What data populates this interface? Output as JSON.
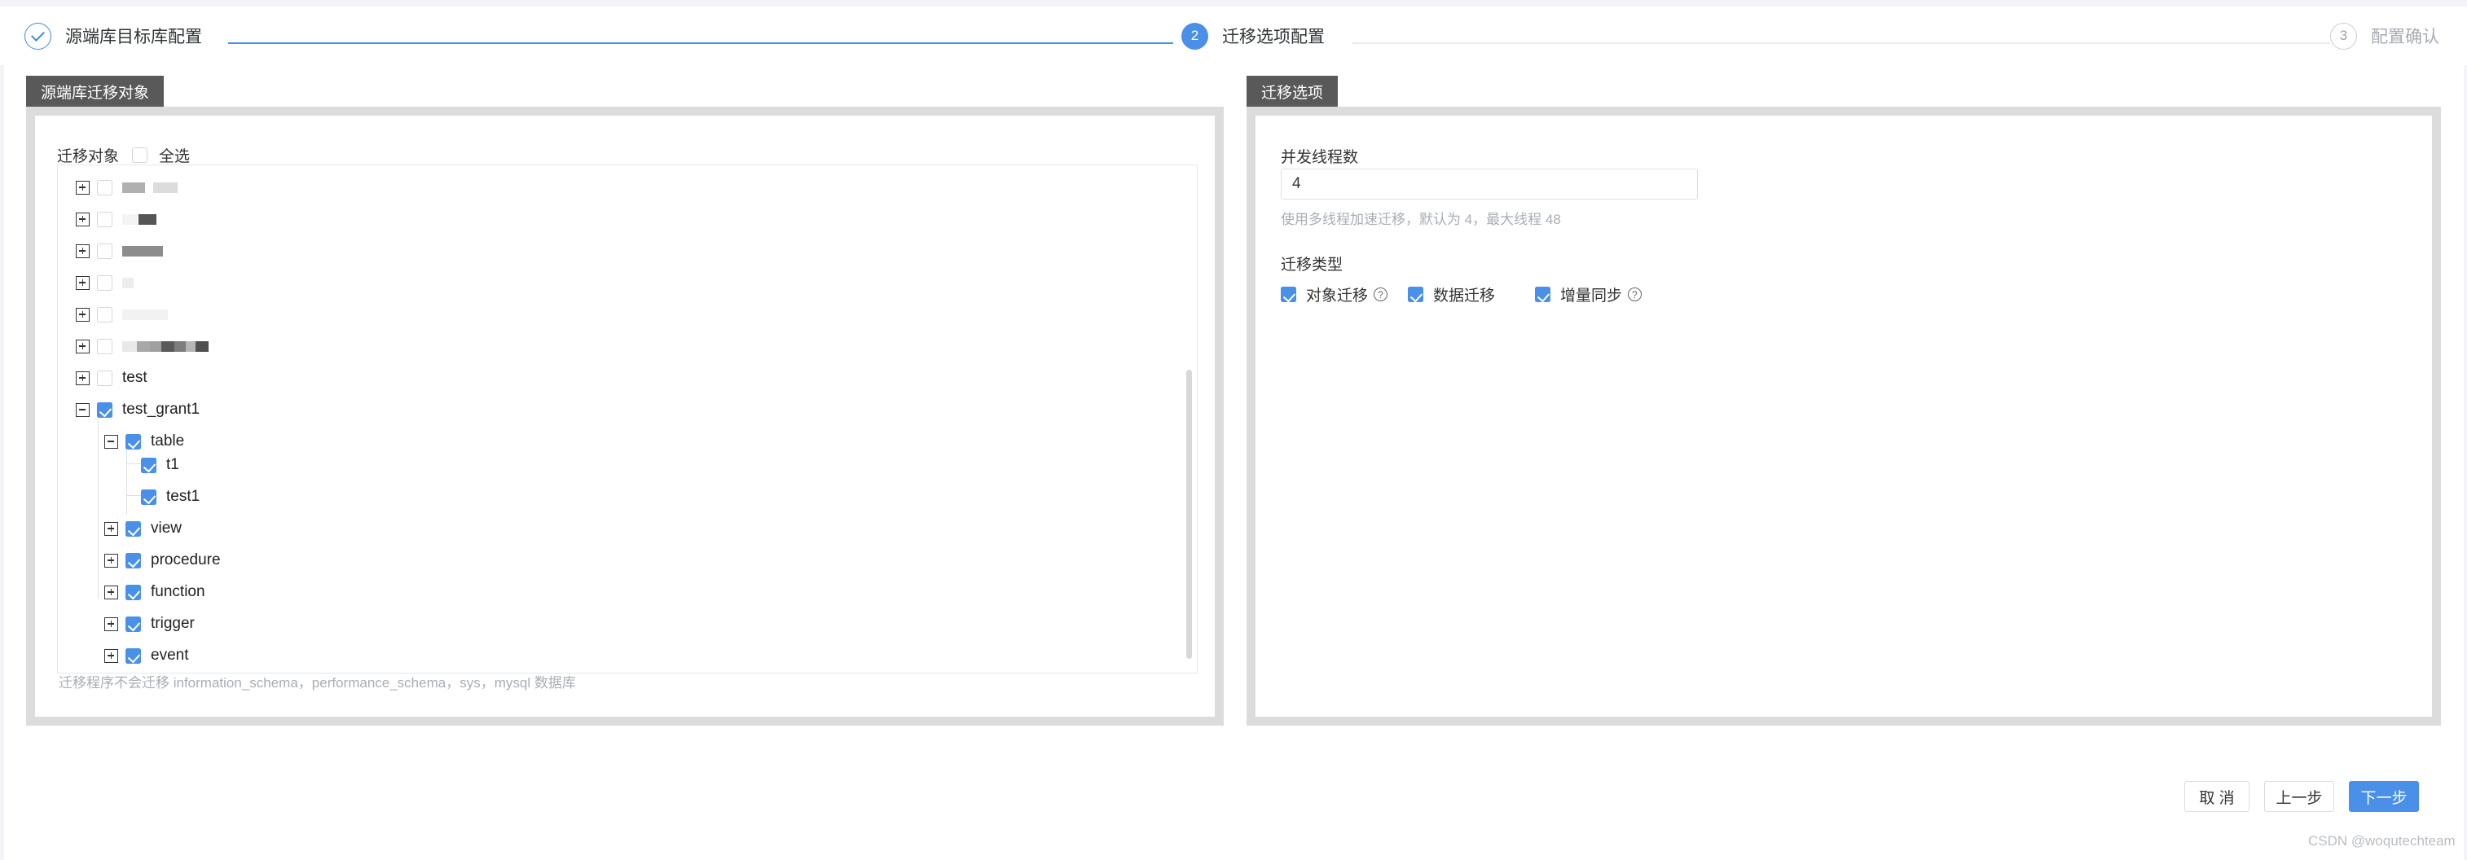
{
  "stepper": {
    "steps": [
      {
        "id": "1",
        "label": "源端库目标库配置",
        "state": "done",
        "marker": "check"
      },
      {
        "id": "2",
        "label": "迁移选项配置",
        "state": "active",
        "marker": "2"
      },
      {
        "id": "3",
        "label": "配置确认",
        "state": "todo",
        "marker": "3"
      }
    ]
  },
  "left_panel": {
    "tab_label": "源端库迁移对象",
    "tree_header": {
      "label": "迁移对象",
      "select_all_label": "全选",
      "select_all_checked": false
    },
    "tree": [
      {
        "level": 0,
        "label": "",
        "redacted": true,
        "expander": "plus",
        "checked": false
      },
      {
        "level": 0,
        "label": "",
        "redacted": true,
        "expander": "plus",
        "checked": false
      },
      {
        "level": 0,
        "label": "",
        "redacted": true,
        "expander": "plus",
        "checked": false
      },
      {
        "level": 0,
        "label": "",
        "redacted": true,
        "expander": "plus",
        "checked": false
      },
      {
        "level": 0,
        "label": "",
        "redacted": true,
        "expander": "plus",
        "checked": false
      },
      {
        "level": 0,
        "label": "",
        "redacted": true,
        "expander": "plus",
        "checked": false
      },
      {
        "level": 0,
        "label": "test",
        "redacted": false,
        "expander": "plus",
        "checked": false
      },
      {
        "level": 0,
        "label": "test_grant1",
        "redacted": false,
        "expander": "minus",
        "checked": true
      },
      {
        "level": 1,
        "label": "table",
        "redacted": false,
        "expander": "minus",
        "checked": true
      },
      {
        "level": 2,
        "label": "t1",
        "redacted": false,
        "expander": "none",
        "checked": true
      },
      {
        "level": 2,
        "label": "test1",
        "redacted": false,
        "expander": "none",
        "checked": true
      },
      {
        "level": 1,
        "label": "view",
        "redacted": false,
        "expander": "plus",
        "checked": true
      },
      {
        "level": 1,
        "label": "procedure",
        "redacted": false,
        "expander": "plus",
        "checked": true
      },
      {
        "level": 1,
        "label": "function",
        "redacted": false,
        "expander": "plus",
        "checked": true
      },
      {
        "level": 1,
        "label": "trigger",
        "redacted": false,
        "expander": "plus",
        "checked": true
      },
      {
        "level": 1,
        "label": "event",
        "redacted": false,
        "expander": "plus",
        "checked": true
      }
    ],
    "note": "迁移程序不会迁移 information_schema，performance_schema，sys，mysql 数据库"
  },
  "right_panel": {
    "tab_label": "迁移选项",
    "thread_field": {
      "label": "并发线程数",
      "value": "4",
      "placeholder": "",
      "hint": "使用多线程加速迁移，默认为 4，最大线程 48"
    },
    "migration_type": {
      "label": "迁移类型",
      "options": [
        {
          "label": "对象迁移",
          "checked": true,
          "help": true
        },
        {
          "label": "数据迁移",
          "checked": true,
          "help": false
        },
        {
          "label": "增量同步",
          "checked": true,
          "help": true
        }
      ]
    }
  },
  "footer": {
    "cancel_label": "取 消",
    "prev_label": "上一步",
    "next_label": "下一步",
    "watermark": "CSDN @woqutechteam"
  },
  "colors": {
    "accent": "#4a90e8",
    "step_line_active": "#4096e8",
    "step_line_inactive": "#e8eaec",
    "tab_bg": "#595959",
    "panel_border": "#dcdcdc"
  },
  "icons": {
    "check": "check-icon",
    "help": "?"
  }
}
